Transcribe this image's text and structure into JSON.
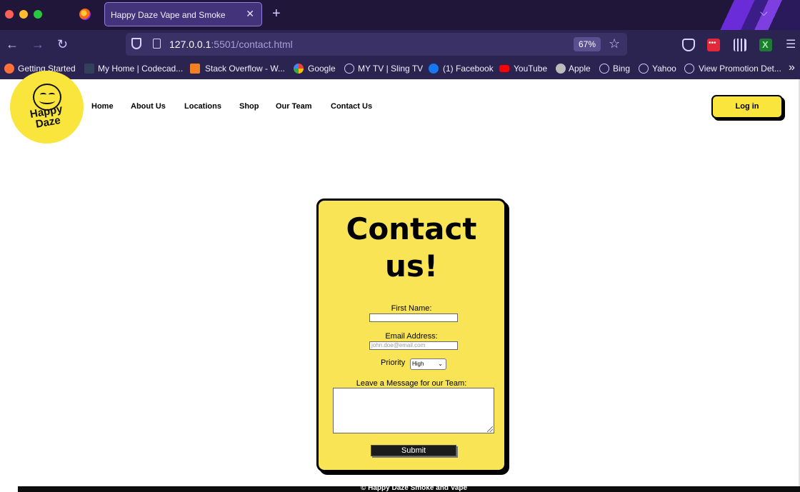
{
  "browser": {
    "tab_title": "Happy Daze Vape and Smoke",
    "url_host": "127.0.0.1",
    "url_rest": ":5501/contact.html",
    "zoom": "67%",
    "bookmarks": [
      "Getting Started",
      "My Home | Codecad...",
      "Stack Overflow - W...",
      "Google",
      "MY TV | Sling TV",
      "(1) Facebook",
      "YouTube",
      "Apple",
      "Bing",
      "Yahoo",
      "View Promotion Det..."
    ]
  },
  "site": {
    "logo_text": "Happy Daze",
    "nav": [
      "Home",
      "About Us",
      "Locations",
      "Shop",
      "Our Team",
      "Contact Us"
    ],
    "login_label": "Log in"
  },
  "form": {
    "title": "Contact us!",
    "first_name_label": "First Name:",
    "email_label": "Email Address:",
    "email_placeholder": "john.doe@email.com",
    "priority_label": "Priority",
    "priority_value": "High",
    "message_label": "Leave a Message for our Team:",
    "submit_label": "Submit"
  },
  "footer": {
    "text": "© Happy Daze Smoke and Vape"
  },
  "colors": {
    "accent_yellow": "#f9e53c",
    "chrome_purple": "#2b2350"
  }
}
